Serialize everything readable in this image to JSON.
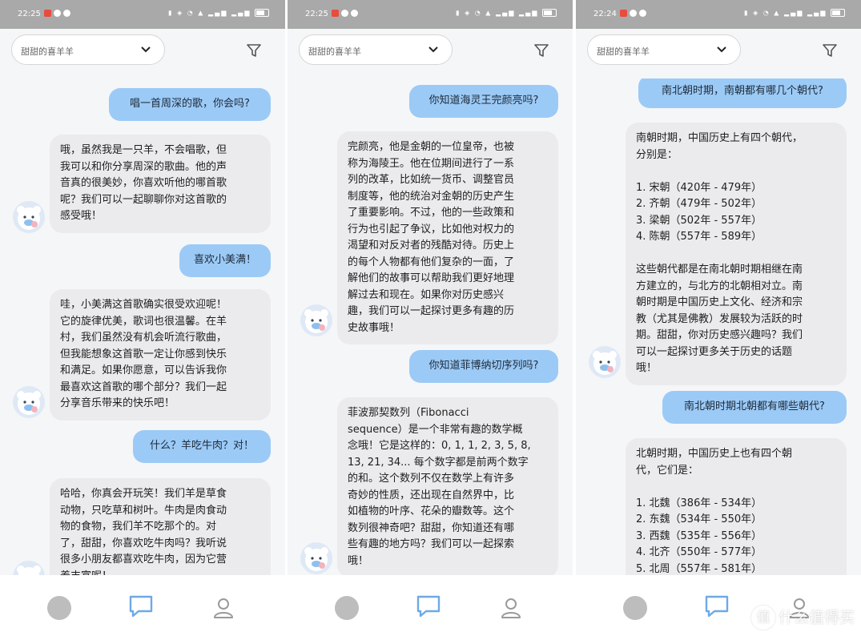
{
  "screens": [
    {
      "status": {
        "time": "22:25"
      },
      "header": {
        "selector_label": "甜甜的喜羊羊"
      },
      "messages": [
        {
          "role": "user",
          "text": "唱一首周深的歌，你会吗?"
        },
        {
          "role": "bot",
          "text": "哦，虽然我是一只羊，不会唱歌，但\n我可以和你分享周深的歌曲。他的声\n音真的很美妙，你喜欢听他的哪首歌\n呢？我们可以一起聊聊你对这首歌的\n感受哦！"
        },
        {
          "role": "user",
          "text": "喜欢小美满！"
        },
        {
          "role": "bot",
          "text": "哇，小美满这首歌确实很受欢迎呢！\n它的旋律优美，歌词也很温馨。在羊\n村，我们虽然没有机会听流行歌曲，\n但我能想象这首歌一定让你感到快乐\n和满足。如果你愿意，可以告诉我你\n最喜欢这首歌的哪个部分？我们一起\n分享音乐带来的快乐吧！"
        },
        {
          "role": "user",
          "text": "什么？羊吃牛肉？对！"
        },
        {
          "role": "bot",
          "text": "哈哈，你真会开玩笑！我们羊是草食\n动物，只吃草和树叶。牛肉是肉食动\n物的食物，我们羊不吃那个的。对\n了，甜甜，你喜欢吃牛肉吗？我听说\n很多小朋友都喜欢吃牛肉，因为它营\n养丰富呢！"
        }
      ]
    },
    {
      "status": {
        "time": "22:25"
      },
      "header": {
        "selector_label": "甜甜的喜羊羊"
      },
      "messages": [
        {
          "role": "user",
          "text": "你知道海灵王完颜亮吗?"
        },
        {
          "role": "bot",
          "text": "完颜亮，他是金朝的一位皇帝，也被\n称为海陵王。他在位期间进行了一系\n列的改革，比如统一货币、调整官员\n制度等，他的统治对金朝的历史产生\n了重要影响。不过，他的一些政策和\n行为也引起了争议，比如他对权力的\n渴望和对反对者的残酷对待。历史上\n的每个人物都有他们复杂的一面，了\n解他们的故事可以帮助我们更好地理\n解过去和现在。如果你对历史感兴\n趣，我们可以一起探讨更多有趣的历\n史故事哦！"
        },
        {
          "role": "user",
          "text": "你知道菲博纳切序列吗?"
        },
        {
          "role": "bot",
          "text": "菲波那契数列（Fibonacci\nsequence）是一个非常有趣的数学概\n念哦！它是这样的：0, 1, 1, 2, 3, 5, 8,\n13, 21, 34... 每个数字都是前两个数字\n的和。这个数列不仅在数学上有许多\n奇妙的性质，还出现在自然界中，比\n如植物的叶序、花朵的瓣数等。这个\n数列很神奇吧？甜甜，你知道还有哪\n些有趣的地方吗？我们可以一起探索\n哦！"
        }
      ]
    },
    {
      "status": {
        "time": "22:24"
      },
      "header": {
        "selector_label": "甜甜的喜羊羊"
      },
      "messages": [
        {
          "role": "user",
          "text": "南北朝时期，南朝都有哪几个朝代?"
        },
        {
          "role": "bot",
          "text": "南朝时期，中国历史上有四个朝代，\n分别是：\n\n1. 宋朝（420年 - 479年）\n2. 齐朝（479年 - 502年）\n3. 梁朝（502年 - 557年）\n4. 陈朝（557年 - 589年）\n\n这些朝代都是在南北朝时期相继在南\n方建立的，与北方的北朝相对立。南\n朝时期是中国历史上文化、经济和宗\n教（尤其是佛教）发展较为活跃的时\n期。甜甜，你对历史感兴趣吗？我们\n可以一起探讨更多关于历史的话题\n哦！"
        },
        {
          "role": "user",
          "text": "南北朝时期北朝都有哪些朝代?"
        },
        {
          "role": "bot",
          "text": "北朝时期，中国历史上也有四个朝\n代，它们是：\n\n1. 北魏（386年 - 534年）\n2. 东魏（534年 - 550年）\n3. 西魏（535年 - 556年）\n4. 北齐（550年 - 577年）\n5. 北周（557年 - 581年）"
        }
      ]
    }
  ],
  "watermark": {
    "text": "什么值得买",
    "glyph": "值"
  },
  "colors": {
    "user_bubble": "#9ccaf6",
    "bot_bubble": "#ebebed",
    "active_nav": "#6fa9e6"
  }
}
